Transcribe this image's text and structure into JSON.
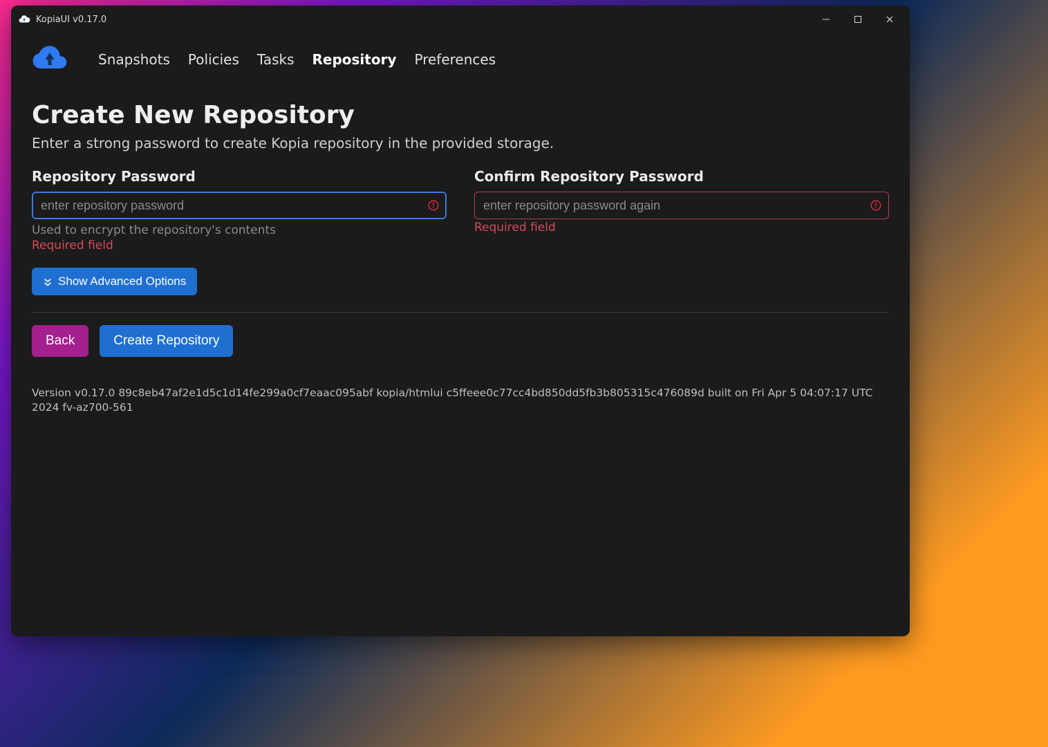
{
  "window": {
    "title": "KopiaUI v0.17.0"
  },
  "nav": {
    "items": [
      {
        "label": "Snapshots",
        "active": false
      },
      {
        "label": "Policies",
        "active": false
      },
      {
        "label": "Tasks",
        "active": false
      },
      {
        "label": "Repository",
        "active": true
      },
      {
        "label": "Preferences",
        "active": false
      }
    ]
  },
  "page": {
    "title": "Create New Repository",
    "subtitle": "Enter a strong password to create Kopia repository in the provided storage."
  },
  "form": {
    "password": {
      "label": "Repository Password",
      "placeholder": "enter repository password",
      "value": "",
      "help": "Used to encrypt the repository's contents",
      "error": "Required field"
    },
    "confirm": {
      "label": "Confirm Repository Password",
      "placeholder": "enter repository password again",
      "value": "",
      "error": "Required field"
    },
    "advanced_label": "Show Advanced Options"
  },
  "actions": {
    "back": "Back",
    "create": "Create Repository"
  },
  "version_line": "Version v0.17.0 89c8eb47af2e1d5c1d14fe299a0cf7eaac095abf kopia/htmlui c5ffeee0c77cc4bd850dd5fb3b805315c476089d built on Fri Apr 5 04:07:17 UTC 2024 fv-az700-561"
}
